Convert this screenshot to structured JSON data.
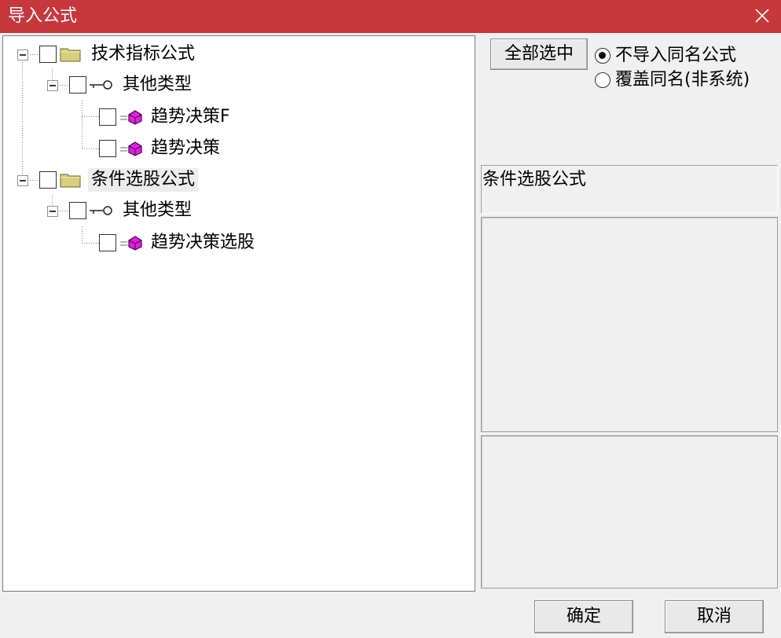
{
  "window": {
    "title": "导入公式",
    "close_icon": "close-icon"
  },
  "tree": {
    "nodes": [
      {
        "label": "技术指标公式",
        "icon": "folder-icon"
      },
      {
        "label": "其他类型",
        "icon": "key-icon"
      },
      {
        "label": "趋势决策F",
        "icon": "formula-gem-icon"
      },
      {
        "label": "趋势决策",
        "icon": "formula-gem-icon"
      },
      {
        "label": "条件选股公式",
        "icon": "folder-icon"
      },
      {
        "label": "其他类型",
        "icon": "key-icon"
      },
      {
        "label": "趋势决策选股",
        "icon": "formula-gem-icon"
      }
    ]
  },
  "options": {
    "select_all_label": "全部选中",
    "radio_skip_label": "不导入同名公式",
    "radio_overwrite_label": "覆盖同名(非系统)",
    "selected": "skip"
  },
  "info": {
    "selected_name": "条件选股公式"
  },
  "footer": {
    "ok_label": "确定",
    "cancel_label": "取消"
  },
  "colors": {
    "titlebar": "#c8373c",
    "gem": "#e020e0",
    "folder": "#d8cf7a"
  }
}
